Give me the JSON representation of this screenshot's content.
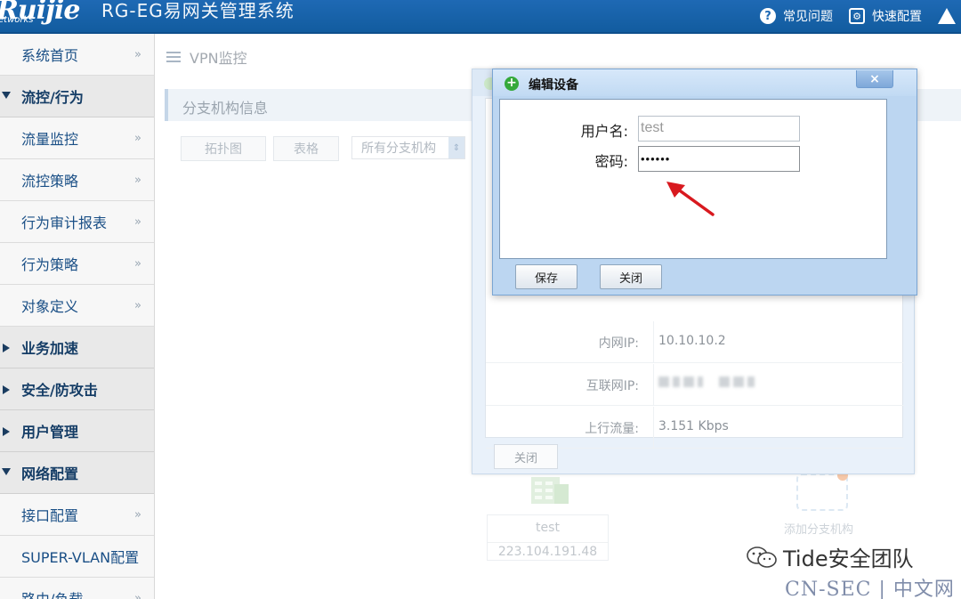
{
  "header": {
    "logo": "Ruijie",
    "logo_sub": "etworks",
    "title": "RG-EG易网关管理系统",
    "links": [
      {
        "label": "常见问题",
        "icon": "help-icon"
      },
      {
        "label": "快速配置",
        "icon": "settings-icon"
      },
      {
        "label": "",
        "icon": "warning-icon"
      }
    ]
  },
  "sidebar": {
    "items": [
      {
        "type": "item",
        "label": "系统首页"
      },
      {
        "type": "group",
        "label": "流控/行为",
        "expanded": true
      },
      {
        "type": "item",
        "label": "流量监控"
      },
      {
        "type": "item",
        "label": "流控策略"
      },
      {
        "type": "item",
        "label": "行为审计报表"
      },
      {
        "type": "item",
        "label": "行为策略"
      },
      {
        "type": "item",
        "label": "对象定义"
      },
      {
        "type": "group",
        "label": "业务加速",
        "expanded": false
      },
      {
        "type": "group",
        "label": "安全/防攻击",
        "expanded": false
      },
      {
        "type": "group",
        "label": "用户管理",
        "expanded": false
      },
      {
        "type": "group",
        "label": "网络配置",
        "expanded": true
      },
      {
        "type": "item",
        "label": "接口配置"
      },
      {
        "type": "item",
        "label": "SUPER-VLAN配置"
      },
      {
        "type": "item",
        "label": "路由/负载"
      }
    ],
    "chevron": "»"
  },
  "main": {
    "breadcrumb": "VPN监控",
    "section_title": "分支机构信息",
    "tabs": [
      "拓扑图",
      "表格"
    ],
    "branch_select": "所有分支机构",
    "node": {
      "name": "test",
      "ip": "223.104.191.48"
    },
    "add_branch_label": "添加分支机构"
  },
  "device_dialog": {
    "rows": [
      {
        "label": "内网IP:",
        "value": "10.10.10.2"
      },
      {
        "label": "互联网IP:",
        "value": ""
      },
      {
        "label": "上行流量:",
        "value": "3.151 Kbps"
      },
      {
        "label": "",
        "value": ""
      }
    ],
    "close_label": "关闭"
  },
  "edit_dialog": {
    "title": "编辑设备",
    "username_label": "用户名:",
    "username_value": "test",
    "password_label": "密码:",
    "password_value": "••••••",
    "save_label": "保存",
    "close_label": "关闭",
    "x_label": "×"
  },
  "watermark": {
    "line1": "Tide安全团队",
    "line2": "CN-SEC | 中文网"
  },
  "colors": {
    "header": "#1e69b4",
    "annotation_arrow": "#d8191f",
    "dialog_frame": "#bcd6f1"
  }
}
